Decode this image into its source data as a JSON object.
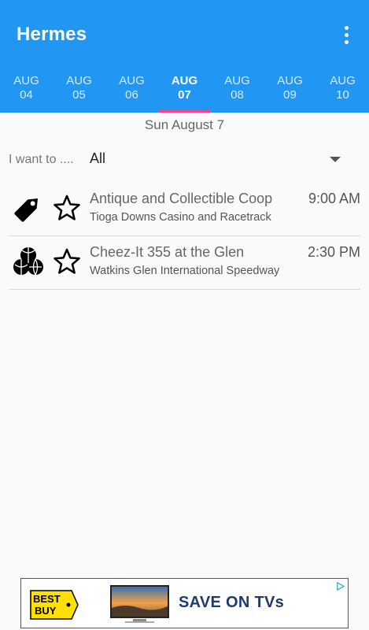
{
  "app": {
    "title": "Hermes"
  },
  "tabs": [
    {
      "month": "AUG",
      "day": "04",
      "active": false
    },
    {
      "month": "AUG",
      "day": "05",
      "active": false
    },
    {
      "month": "AUG",
      "day": "06",
      "active": false
    },
    {
      "month": "AUG",
      "day": "07",
      "active": true
    },
    {
      "month": "AUG",
      "day": "08",
      "active": false
    },
    {
      "month": "AUG",
      "day": "09",
      "active": false
    },
    {
      "month": "AUG",
      "day": "10",
      "active": false
    }
  ],
  "date_header": "Sun August 7",
  "filter": {
    "label": "I want to ....",
    "value": "All"
  },
  "events": [
    {
      "name": "Antique and Collectible Coop",
      "time": "9:00 AM",
      "venue": "Tioga Downs Casino and Racetrack",
      "icon": "price-tag-icon",
      "favorited": false
    },
    {
      "name": "Cheez-It 355 at the Glen",
      "time": "2:30 PM",
      "venue": "Watkins Glen International Speedway",
      "icon": "sports-balls-icon",
      "favorited": false
    }
  ],
  "ad": {
    "brand": "BEST BUY",
    "text": "SAVE ON TVs",
    "colors": {
      "brand_yellow": "#ffe000",
      "brand_text": "#1f3a6e"
    }
  },
  "colors": {
    "appbar": "#2196f3",
    "indicator": "#ff4081"
  }
}
